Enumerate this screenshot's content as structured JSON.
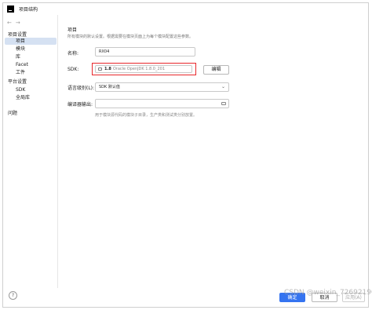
{
  "window": {
    "title": "项目结构"
  },
  "sidebar": {
    "groups": [
      {
        "label": "项目设置",
        "items": [
          "项目",
          "模块",
          "库",
          "Facet",
          "工件"
        ]
      },
      {
        "label": "平台设置",
        "items": [
          "SDK",
          "全局库"
        ]
      }
    ],
    "problems": "问题",
    "selected": "项目",
    "help": "?"
  },
  "main": {
    "title": "项目",
    "description": "所有模块的默认设置。根据需要在模块页面上为每个模块配置这些参数。",
    "name_label": "名称:",
    "name_value": "RX04",
    "sdk_label": "SDK:",
    "sdk_version": "1.8",
    "sdk_detail": "Oracle OpenJDK 1.8.0_201",
    "edit_button": "编辑",
    "language_level_label": "语言级别(L):",
    "language_level_value": "SDK 默认值",
    "output_label": "编译器输出:",
    "output_value": "",
    "output_hint": "用于模块源代码的模块子目录，生产类和测试类分别放置。"
  },
  "footer": {
    "ok": "确定",
    "cancel": "取消",
    "apply": "应用(A)"
  },
  "watermark": "CSDN @weixin_72692190",
  "colors": {
    "accent": "#3574f0",
    "highlight": "#e8272b",
    "selection": "#d5e1f2"
  }
}
